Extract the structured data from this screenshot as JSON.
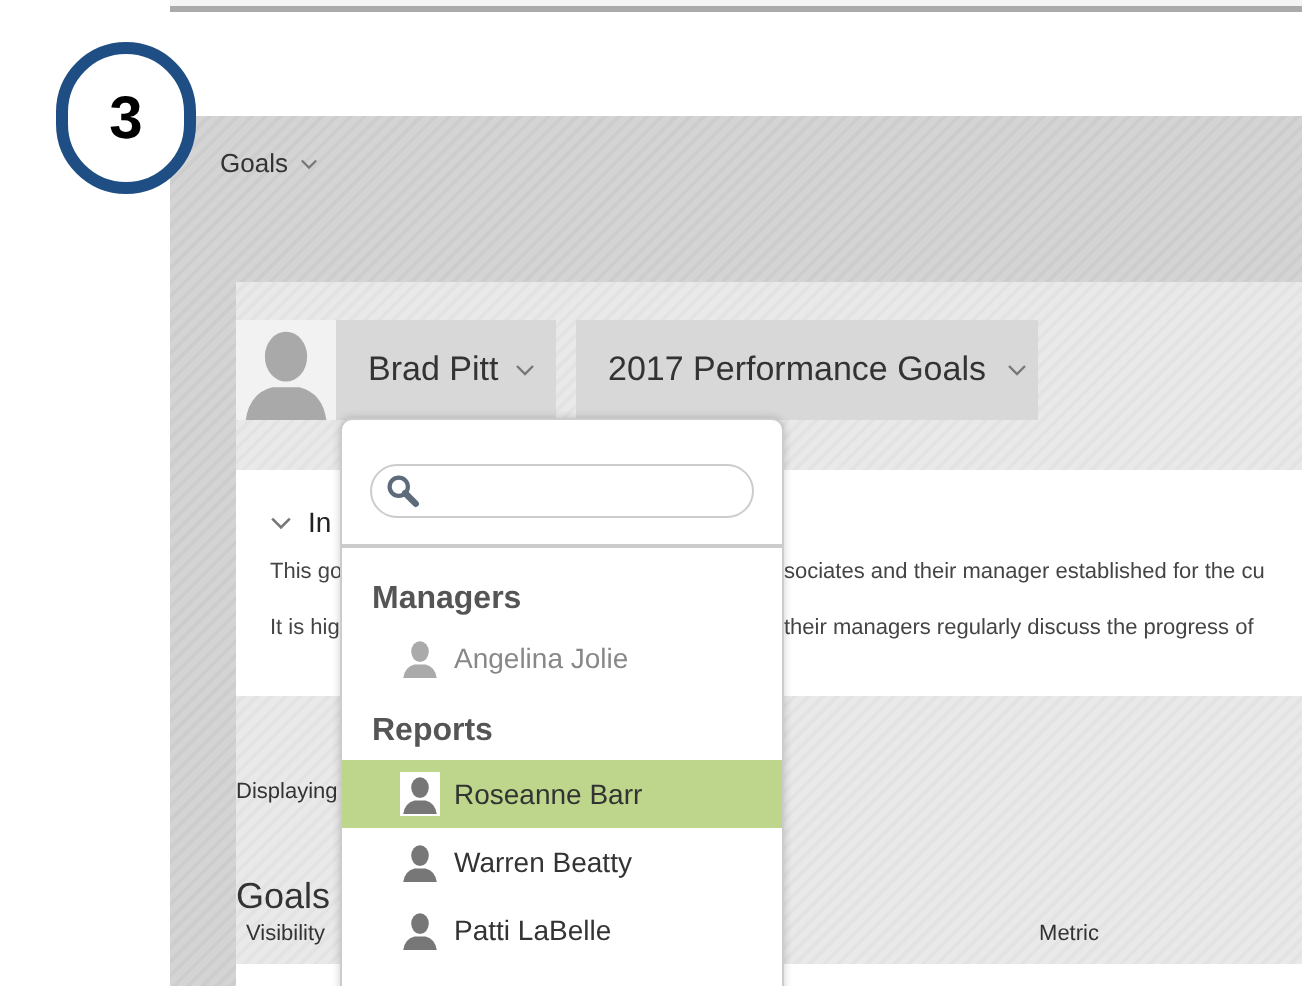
{
  "step_badge": "3",
  "nav": {
    "label": "Goals"
  },
  "header": {
    "person": "Brad Pitt",
    "period": "2017 Performance Goals"
  },
  "info_card": {
    "title": "In",
    "lines": [
      [
        "This go",
        "sociates and their manager established for the cu"
      ],
      [
        "It is hig",
        "their managers regularly discuss the progress of"
      ]
    ]
  },
  "displaying": "Displaying",
  "goals": {
    "title": "Goals",
    "columns": [
      "Visibility",
      "Metric"
    ]
  },
  "dropdown": {
    "groups": [
      {
        "title": "Managers",
        "items": [
          {
            "name": "Angelina Jolie",
            "selected": false,
            "disabled": true
          }
        ]
      },
      {
        "title": "Reports",
        "items": [
          {
            "name": "Roseanne Barr",
            "selected": true,
            "disabled": false
          },
          {
            "name": "Warren Beatty",
            "selected": false,
            "disabled": false
          },
          {
            "name": "Patti LaBelle",
            "selected": false,
            "disabled": false
          }
        ]
      }
    ]
  }
}
